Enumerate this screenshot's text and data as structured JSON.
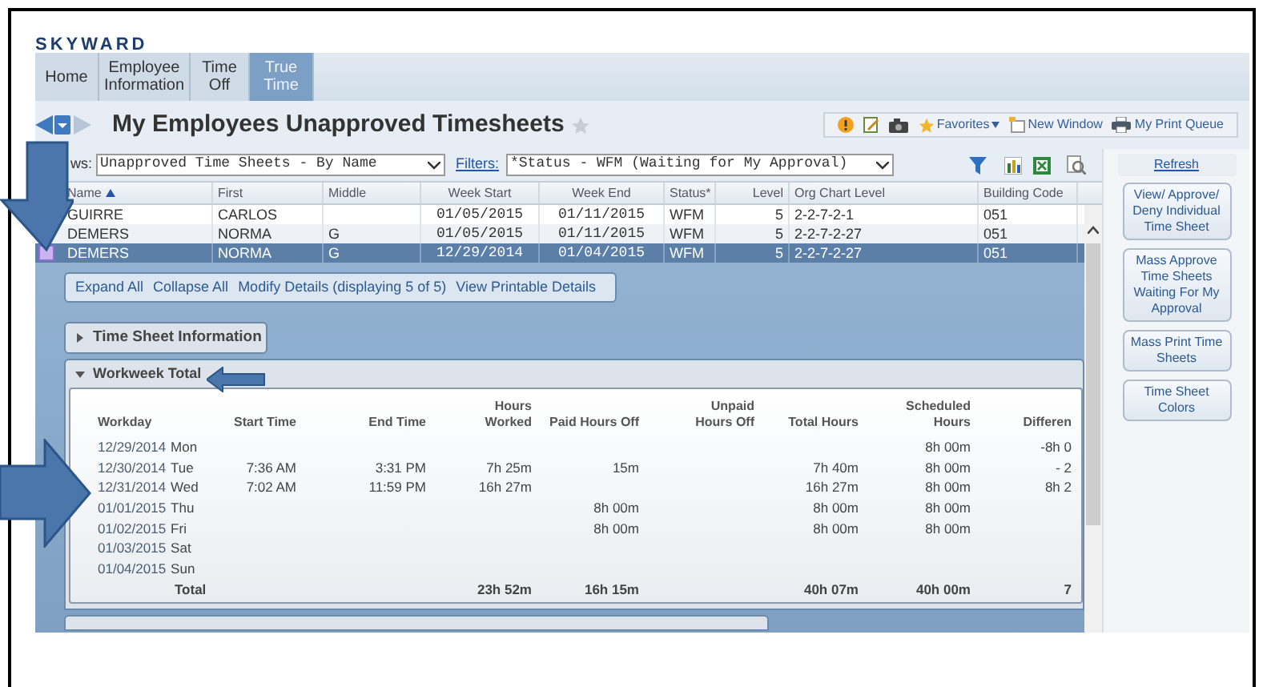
{
  "logo": "SKYWARD",
  "tabs": [
    {
      "label": "Home",
      "selected": false
    },
    {
      "label": "Employee Information",
      "selected": false
    },
    {
      "label": "Time Off",
      "selected": false
    },
    {
      "label": "True Time",
      "selected": true
    }
  ],
  "page_title": "My Employees Unapproved Timesheets",
  "toolbar": {
    "favorites": "Favorites",
    "new_window": "New Window",
    "print_queue": "My Print Queue"
  },
  "views": {
    "label": "ws:",
    "value": "Unapproved Time Sheets - By Name"
  },
  "filters": {
    "label": "Filters:",
    "value": "*Status - WFM (Waiting for My Approval)"
  },
  "refresh": "Refresh",
  "table": {
    "columns": [
      "Name",
      "First",
      "Middle",
      "Week Start",
      "Week End",
      "Status*",
      "Level",
      "Org Chart Level",
      "Building Code"
    ],
    "rows": [
      {
        "selected": false,
        "cells": [
          "GUIRRE",
          "CARLOS",
          "",
          "01/05/2015",
          "01/11/2015",
          "WFM",
          "5",
          "2-2-7-2-1",
          "051"
        ]
      },
      {
        "selected": false,
        "cells": [
          "DEMERS",
          "NORMA",
          "G",
          "01/05/2015",
          "01/11/2015",
          "WFM",
          "5",
          "2-2-7-2-27",
          "051"
        ]
      },
      {
        "selected": true,
        "cells": [
          "DEMERS",
          "NORMA",
          "G",
          "12/29/2014",
          "01/04/2015",
          "WFM",
          "5",
          "2-2-7-2-27",
          "051"
        ]
      }
    ]
  },
  "side_buttons": [
    "View/ Approve/ Deny Individual Time Sheet",
    "Mass Approve Time Sheets Waiting For My Approval",
    "Mass Print Time Sheets",
    "Time Sheet Colors"
  ],
  "detail_links": [
    "Expand All",
    "Collapse All",
    "Modify Details (displaying 5 of 5)",
    "View Printable Details"
  ],
  "sections": [
    {
      "title": "Time Sheet Information",
      "expanded": false
    },
    {
      "title": "Workweek Total",
      "expanded": true
    }
  ],
  "workweek": {
    "columns": [
      "Workday",
      "Start Time",
      "End Time",
      "Hours Worked",
      "Paid Hours Off",
      "Unpaid Hours Off",
      "Total Hours",
      "Scheduled Hours",
      "Differen"
    ],
    "rows": [
      {
        "date": "12/29/2014",
        "day": "Mon",
        "scheduled_hours": "8h 00m",
        "difference": "-8h 0"
      },
      {
        "date": "12/30/2014",
        "day": "Tue",
        "start_time": "7:36 AM",
        "end_time": "3:31 PM",
        "hours_worked": "7h 25m",
        "paid_hours_off": "15m",
        "total_hours": "7h 40m",
        "scheduled_hours": "8h 00m",
        "difference": "- 2"
      },
      {
        "date": "12/31/2014",
        "day": "Wed",
        "start_time": "7:02 AM",
        "end_time": "11:59 PM",
        "hours_worked": "16h 27m",
        "total_hours": "16h 27m",
        "scheduled_hours": "8h 00m",
        "difference": "8h 2"
      },
      {
        "date": "01/01/2015",
        "day": "Thu",
        "paid_hours_off": "8h 00m",
        "total_hours": "8h 00m",
        "scheduled_hours": "8h 00m"
      },
      {
        "date": "01/02/2015",
        "day": "Fri",
        "paid_hours_off": "8h 00m",
        "total_hours": "8h 00m",
        "scheduled_hours": "8h 00m"
      },
      {
        "date": "01/03/2015",
        "day": "Sat"
      },
      {
        "date": "01/04/2015",
        "day": "Sun"
      }
    ],
    "total": {
      "label": "Total",
      "hours_worked": "23h 52m",
      "paid_hours_off": "16h 15m",
      "total_hours": "40h 07m",
      "scheduled_hours": "40h 00m",
      "difference": "7"
    }
  }
}
